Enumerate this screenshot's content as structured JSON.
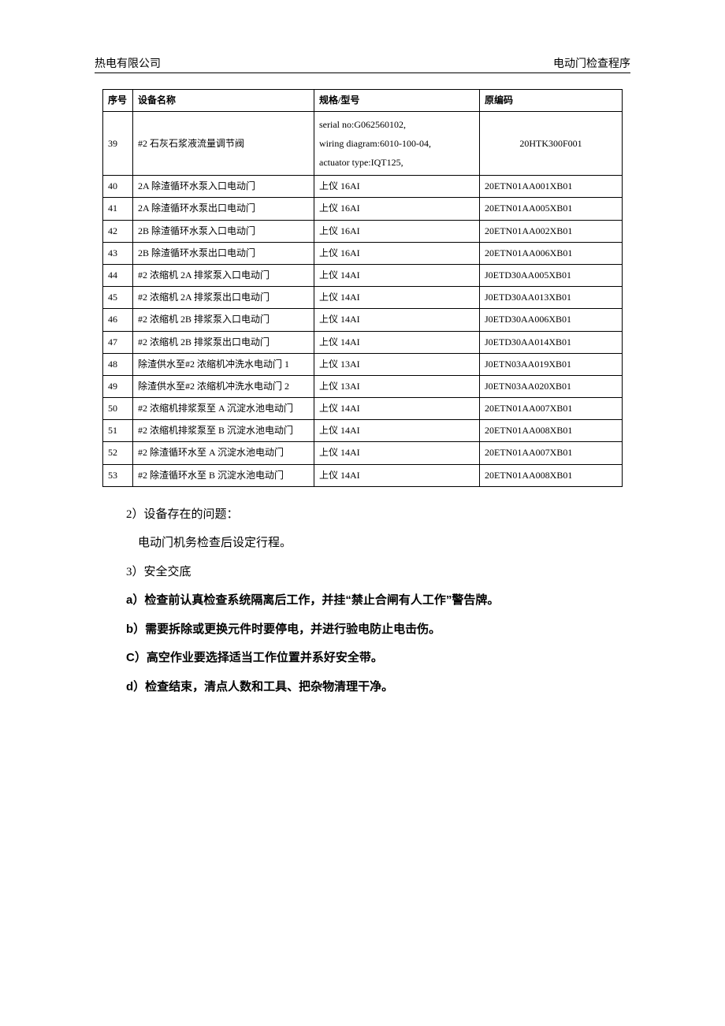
{
  "header": {
    "left": "热电有限公司",
    "right": "电动门检查程序"
  },
  "table": {
    "headers": {
      "idx": "序号",
      "name": "设备名称",
      "spec": "规格/型号",
      "code": "原编码"
    },
    "rows": [
      {
        "idx": "39",
        "name": "#2 石灰石浆液流量调节阀",
        "spec": "serial no:G062560102,\nwiring diagram:6010-100-04,\nactuator type:IQT125,",
        "code": "20HTK300F001"
      },
      {
        "idx": "40",
        "name": "2A 除渣循环水泵入口电动门",
        "spec": "上仪 16AI",
        "code": "20ETN01AA001XB01"
      },
      {
        "idx": "41",
        "name": "2A 除渣循环水泵出口电动门",
        "spec": "上仪 16AI",
        "code": "20ETN01AA005XB01"
      },
      {
        "idx": "42",
        "name": "2B 除渣循环水泵入口电动门",
        "spec": "上仪 16AI",
        "code": "20ETN01AA002XB01"
      },
      {
        "idx": "43",
        "name": "2B 除渣循环水泵出口电动门",
        "spec": "上仪 16AI",
        "code": "20ETN01AA006XB01"
      },
      {
        "idx": "44",
        "name": "#2 浓缩机 2A 排浆泵入口电动门",
        "spec": "上仪 14AI",
        "code": "J0ETD30AA005XB01"
      },
      {
        "idx": "45",
        "name": "#2 浓缩机 2A 排浆泵出口电动门",
        "spec": "上仪 14AI",
        "code": "J0ETD30AA013XB01"
      },
      {
        "idx": "46",
        "name": "#2 浓缩机 2B 排浆泵入口电动门",
        "spec": "上仪 14AI",
        "code": "J0ETD30AA006XB01"
      },
      {
        "idx": "47",
        "name": "#2 浓缩机 2B 排浆泵出口电动门",
        "spec": "上仪 14AI",
        "code": "J0ETD30AA014XB01"
      },
      {
        "idx": "48",
        "name": "除渣供水至#2 浓缩机冲洗水电动门 1",
        "spec": "上仪 13AI",
        "code": "J0ETN03AA019XB01"
      },
      {
        "idx": "49",
        "name": "除渣供水至#2 浓缩机冲洗水电动门 2",
        "spec": "上仪 13AI",
        "code": "J0ETN03AA020XB01"
      },
      {
        "idx": "50",
        "name": "#2 浓缩机排浆泵至 A 沉淀水池电动门",
        "spec": "上仪 14AI",
        "code": "20ETN01AA007XB01"
      },
      {
        "idx": "51",
        "name": "#2 浓缩机排浆泵至 B 沉淀水池电动门",
        "spec": "上仪 14AI",
        "code": "20ETN01AA008XB01"
      },
      {
        "idx": "52",
        "name": "#2 除渣循环水至 A 沉淀水池电动门",
        "spec": "上仪 14AI",
        "code": "20ETN01AA007XB01"
      },
      {
        "idx": "53",
        "name": "#2 除渣循环水至 B 沉淀水池电动门",
        "spec": "上仪 14AI",
        "code": "20ETN01AA008XB01"
      }
    ]
  },
  "content": {
    "line1": "2）设备存在的问题：",
    "line2": "电动门机务检查后设定行程。",
    "line3": "3）安全交底",
    "line4": "a）检查前认真检查系统隔离后工作，并挂“禁止合闸有人工作”警告牌。",
    "line5": "b）需要拆除或更换元件时要停电，并进行验电防止电击伤。",
    "line6": "C）高空作业要选择适当工作位置并系好安全带。",
    "line7": "d）检查结束，清点人数和工具、把杂物清理干净。"
  }
}
